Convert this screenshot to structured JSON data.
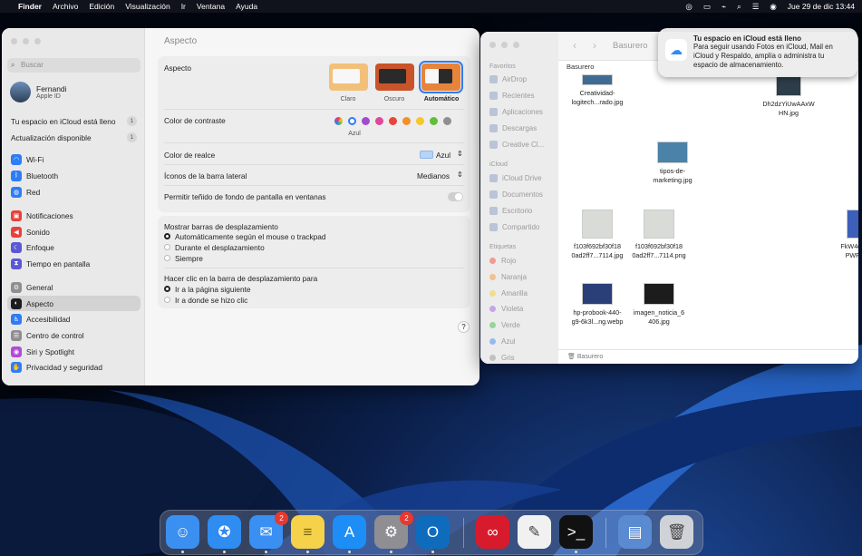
{
  "menubar": {
    "apple": "",
    "app": "Finder",
    "items": [
      "Archivo",
      "Edición",
      "Visualización",
      "Ir",
      "Ventana",
      "Ayuda"
    ],
    "datetime": "Jue 29 de dic  13:44"
  },
  "settings": {
    "search_placeholder": "Buscar",
    "user": {
      "name": "Fernandi",
      "sub": "Apple ID"
    },
    "notices": [
      {
        "label": "Tu espacio en iCloud está lleno",
        "count": "1"
      },
      {
        "label": "Actualización disponible",
        "count": "1"
      }
    ],
    "items": [
      {
        "label": "Wi-Fi",
        "color": "#2f7cf6",
        "icon": "wifi-icon",
        "glyph": "◠"
      },
      {
        "label": "Bluetooth",
        "color": "#2f7cf6",
        "icon": "bluetooth-icon",
        "glyph": "ᛒ"
      },
      {
        "label": "Red",
        "color": "#2f7cf6",
        "icon": "globe-icon",
        "glyph": "◍"
      },
      {
        "label": "Notificaciones",
        "color": "#e8413a",
        "icon": "bell-icon",
        "glyph": "▣"
      },
      {
        "label": "Sonido",
        "color": "#e8413a",
        "icon": "speaker-icon",
        "glyph": "◀"
      },
      {
        "label": "Enfoque",
        "color": "#5b58d6",
        "icon": "moon-icon",
        "glyph": "☾"
      },
      {
        "label": "Tiempo en pantalla",
        "color": "#5b58d6",
        "icon": "hourglass-icon",
        "glyph": "⧗"
      },
      {
        "label": "General",
        "color": "#8e8e93",
        "icon": "gear-icon",
        "glyph": "⚙"
      },
      {
        "label": "Aspecto",
        "color": "#1c1c1e",
        "icon": "appearance-icon",
        "glyph": "◐"
      },
      {
        "label": "Accesibilidad",
        "color": "#2f7cf6",
        "icon": "accessibility-icon",
        "glyph": "♿"
      },
      {
        "label": "Centro de control",
        "color": "#8e8e93",
        "icon": "control-center-icon",
        "glyph": "☰"
      },
      {
        "label": "Siri y Spotlight",
        "color": "#b14bd8",
        "icon": "siri-icon",
        "glyph": "◉"
      },
      {
        "label": "Privacidad y seguridad",
        "color": "#2f7cf6",
        "icon": "hand-icon",
        "glyph": "✋"
      }
    ],
    "selected": "Aspecto",
    "title": "Aspecto",
    "appearance": {
      "label": "Aspecto",
      "options": [
        "Claro",
        "Oscuro",
        "Automático"
      ],
      "selected": "Automático"
    },
    "contrast": {
      "label": "Color de contraste",
      "selected_name": "Azul",
      "colors": [
        "#9a6ae0",
        "#2f7cf6",
        "#a04bcf",
        "#e0479a",
        "#e9443c",
        "#f3902a",
        "#f6c728",
        "#5fbf3b",
        "#8e8e93"
      ]
    },
    "highlight": {
      "label": "Color de realce",
      "value": "Azul"
    },
    "sidebar_icons": {
      "label": "Íconos de la barra lateral",
      "value": "Medianos"
    },
    "tinting": {
      "label": "Permitir teñido de fondo de pantalla en ventanas"
    },
    "scrollbars": {
      "label": "Mostrar barras de desplazamiento",
      "options": [
        "Automáticamente según el mouse o trackpad",
        "Durante el desplazamiento",
        "Siempre"
      ],
      "selected": 0
    },
    "click": {
      "label": "Hacer clic en la barra de desplazamiento para",
      "options": [
        "Ir a la página siguiente",
        "Ir a donde se hizo clic"
      ],
      "selected": 0
    },
    "help": "?"
  },
  "finder": {
    "title": "Basurero",
    "header": "Basurero",
    "favorites_label": "Favoritos",
    "favorites": [
      "AirDrop",
      "Recientes",
      "Aplicaciones",
      "Descargas",
      "Creative Cl..."
    ],
    "icloud_label": "iCloud",
    "icloud": [
      "iCloud Drive",
      "Documentos",
      "Escritorio",
      "Compartido"
    ],
    "tags_label": "Etiquetas",
    "tags": [
      {
        "name": "Rojo",
        "color": "#f19a97"
      },
      {
        "name": "Naranja",
        "color": "#f4c08e"
      },
      {
        "name": "Amarilla",
        "color": "#f3dc8a"
      },
      {
        "name": "Violeta",
        "color": "#c6a6e6"
      },
      {
        "name": "Verde",
        "color": "#93d69a"
      },
      {
        "name": "Azul",
        "color": "#95baf1"
      },
      {
        "name": "Gris",
        "color": "#c1c1c1"
      }
    ],
    "files": [
      {
        "name": "Creatividad-\nlogitech...rado.jpg"
      },
      {
        "name": "Dh2dzYiUwAAxW\nHN.jpg"
      },
      {
        "name": "tipos-de-\nmarketing.jpg"
      },
      {
        "name": "f103f692bf30f18\n0ad2ff7...7114.jpg"
      },
      {
        "name": "f103f692bf30f18\n0ad2ff7...7114.png"
      },
      {
        "name": "FkW4qQ9X\nPWF.jpg"
      },
      {
        "name": "hp-probook-440-\ng9-6k3l...ng.webp"
      },
      {
        "name": "imagen_noticia_6\n406.jpg"
      }
    ],
    "path": "Basurero"
  },
  "notification": {
    "title": "Tu espacio en iCloud está lleno",
    "body": "Para seguir usando Fotos en iCloud, Mail en iCloud y Respaldo, amplía o administra tu espacio de almacenamiento."
  },
  "dock": {
    "apps": [
      {
        "name": "Finder",
        "icon": "finder-icon",
        "color": "#3b8ff0",
        "badge": ""
      },
      {
        "name": "Safari",
        "icon": "safari-icon",
        "color": "#2f8cf0",
        "badge": ""
      },
      {
        "name": "Mail",
        "icon": "mail-icon",
        "color": "#3a8ff2",
        "badge": "2"
      },
      {
        "name": "Notas",
        "icon": "notes-icon",
        "color": "#f6d14a",
        "badge": ""
      },
      {
        "name": "App Store",
        "icon": "app-store-icon",
        "color": "#1d8ef5",
        "badge": ""
      },
      {
        "name": "Configuración",
        "icon": "settings-icon",
        "color": "#8e8e93",
        "badge": "2"
      },
      {
        "name": "Outlook",
        "icon": "outlook-icon",
        "color": "#0f6cbd",
        "badge": ""
      },
      {
        "name": "Creative Cloud",
        "icon": "creative-cloud-icon",
        "color": "#d81b2c",
        "badge": ""
      },
      {
        "name": "TextEdit",
        "icon": "textedit-icon",
        "color": "#f1f1f1",
        "badge": ""
      },
      {
        "name": "Terminal",
        "icon": "terminal-icon",
        "color": "#111",
        "badge": ""
      },
      {
        "name": "Descargas",
        "icon": "downloads-stack-icon",
        "color": "#5a8bd0",
        "badge": ""
      },
      {
        "name": "Papelera",
        "icon": "trash-icon",
        "color": "#cfd3d8",
        "badge": ""
      }
    ]
  }
}
